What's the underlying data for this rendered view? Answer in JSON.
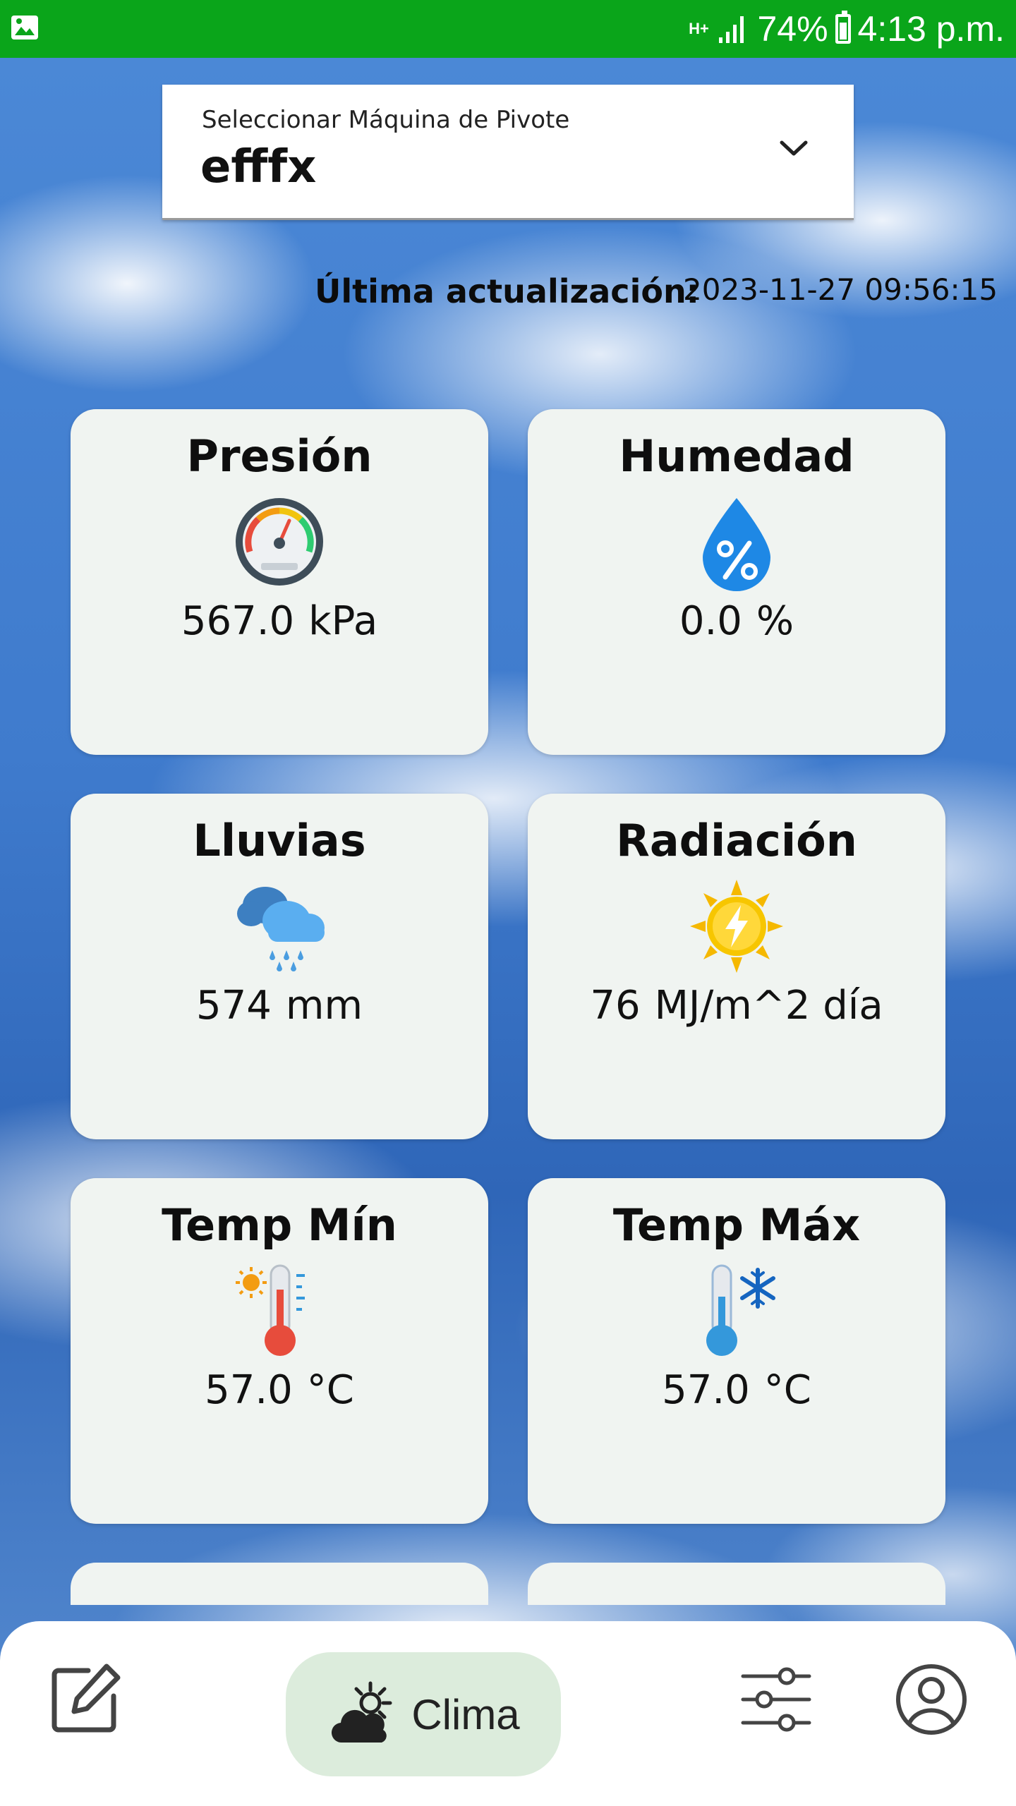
{
  "status_bar": {
    "network": "H+",
    "battery": "74%",
    "time": "4:13 p.m."
  },
  "selector": {
    "label": "Seleccionar Máquina de Pivote",
    "value": "efffx"
  },
  "last_update": {
    "label": "Última actualización:",
    "value": "2023-11-27 09:56:15"
  },
  "cards": [
    {
      "title": "Presión",
      "value": "567.0",
      "unit": "kPa",
      "icon": "gauge-icon"
    },
    {
      "title": "Humedad",
      "value": "0.0",
      "unit": "%",
      "icon": "humidity-drop-icon"
    },
    {
      "title": "Lluvias",
      "value": "574",
      "unit": "mm",
      "icon": "rain-cloud-icon"
    },
    {
      "title": "Radiación",
      "value": "76",
      "unit": "MJ/m^2 día",
      "icon": "sun-radiation-icon"
    },
    {
      "title": "Temp Mín",
      "value": "57.0",
      "unit": "°C",
      "icon": "thermometer-hot-icon"
    },
    {
      "title": "Temp Máx",
      "value": "57.0",
      "unit": "°C",
      "icon": "thermometer-cold-icon"
    }
  ],
  "nav": {
    "active_label": "Clima",
    "items": [
      "edit-icon",
      "weather-icon",
      "settings-sliders-icon",
      "profile-icon"
    ]
  },
  "colors": {
    "status_bar": "#0aa51a",
    "card_bg": "#f0f4f1",
    "nav_active_bg": "#dcecdc"
  }
}
